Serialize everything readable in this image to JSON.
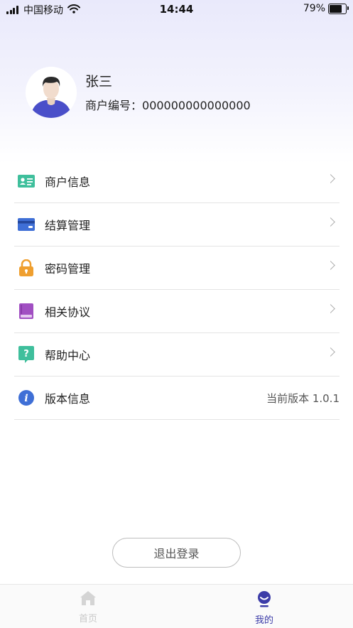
{
  "status_bar": {
    "carrier": "中国移动",
    "time": "14:44",
    "battery_percent": "79%",
    "battery_level": 0.79
  },
  "profile": {
    "name": "张三",
    "merchant_label": "商户编号：",
    "merchant_id": "000000000000000"
  },
  "menu": {
    "items": [
      {
        "label": "商户信息",
        "icon": "id-card-icon",
        "color": "#3fbf9c"
      },
      {
        "label": "结算管理",
        "icon": "credit-card-icon",
        "color": "#3f6fd6"
      },
      {
        "label": "密码管理",
        "icon": "lock-icon",
        "color": "#ef9f2f"
      },
      {
        "label": "相关协议",
        "icon": "book-icon",
        "color": "#a14fc2"
      },
      {
        "label": "帮助中心",
        "icon": "help-icon",
        "color": "#3fbf9c"
      },
      {
        "label": "版本信息",
        "icon": "info-icon",
        "color": "#3f6fd6"
      }
    ],
    "version_value": "当前版本 1.0.1"
  },
  "logout": {
    "label": "退出登录"
  },
  "tab_bar": {
    "tabs": [
      {
        "label": "首页",
        "icon": "home-icon",
        "active": false
      },
      {
        "label": "我的",
        "icon": "profile-icon",
        "active": true
      }
    ],
    "active_color": "#3c3ca8",
    "inactive_color": "#c8c8c8"
  }
}
